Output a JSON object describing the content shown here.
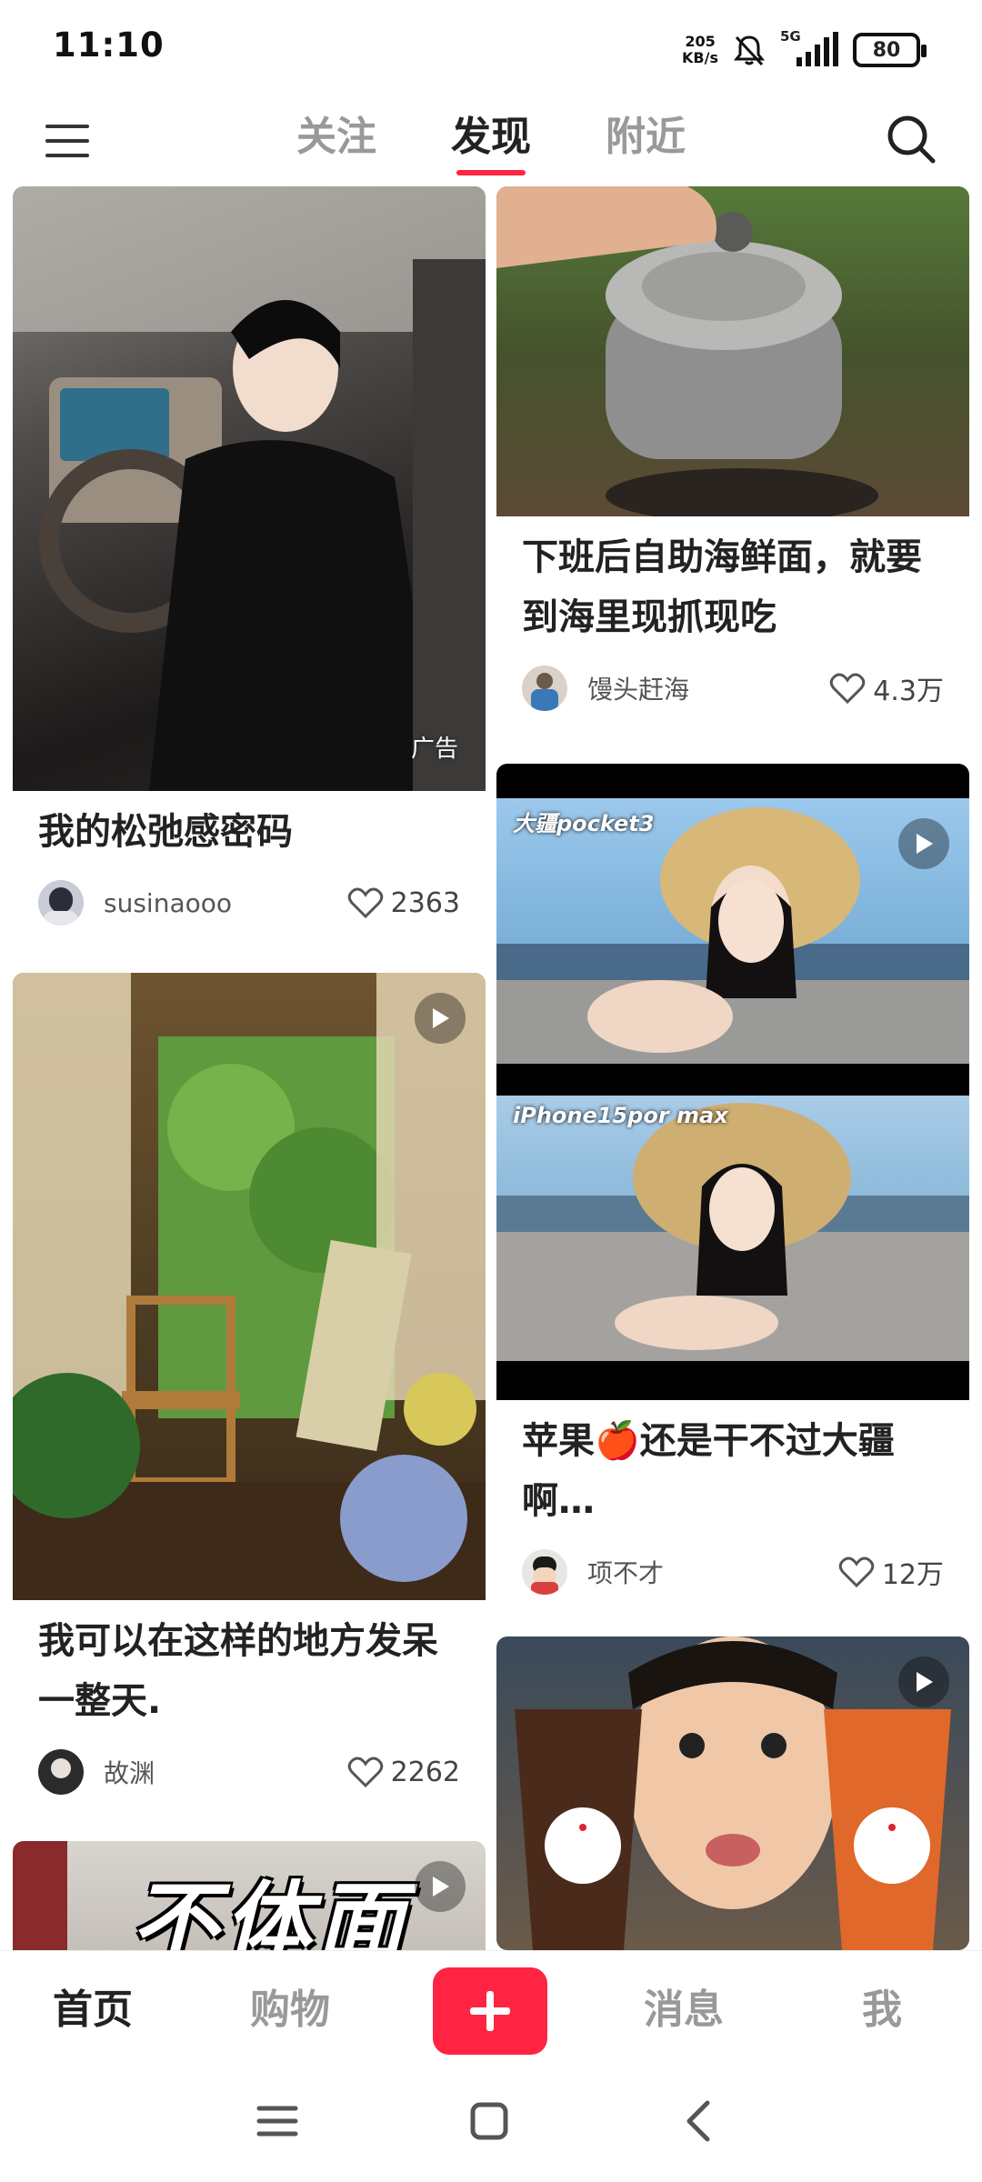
{
  "status_bar": {
    "time": "11:10",
    "net_speed_value": "205",
    "net_speed_unit": "KB/s",
    "network": "5G",
    "battery": "80"
  },
  "top_nav": {
    "tabs": [
      "关注",
      "发现",
      "附近"
    ],
    "active_tab": "发现"
  },
  "feed": {
    "left": [
      {
        "title": "我的松弛感密码",
        "author": "susinaooo",
        "likes": "2363",
        "ad_label": "广告",
        "colors": {
          "bg": "#3a3634",
          "accent": "#c8b8a6"
        }
      },
      {
        "title": "我可以在这样的地方发呆一整天.",
        "author": "故渊",
        "likes": "2262",
        "colors": {
          "bg": "#5a4a30",
          "accent": "#4f8a3a"
        }
      },
      {
        "overlay_text": "不体面"
      }
    ],
    "right": [
      {
        "title": "下班后自助海鲜面，就要到海里现抓现吃",
        "author": "馒头赶海",
        "likes": "4.3万",
        "colors": {
          "bg": "#4d5e36",
          "accent": "#9aa0a6"
        }
      },
      {
        "title": "苹果🍎还是干不过大疆啊…",
        "author": "项不才",
        "likes": "12万",
        "top_label": "大疆pocket3",
        "bottom_label": "iPhone15por max",
        "colors": {
          "bg": "#7ab0d8",
          "accent": "#c9a86a"
        }
      },
      {
        "colors": {
          "bg": "#6a4a3a",
          "accent": "#e0682a"
        }
      }
    ]
  },
  "bottom_nav": {
    "items": [
      "首页",
      "购物",
      "消息",
      "我"
    ],
    "active": "首页",
    "publish_color": "#ff2442"
  }
}
